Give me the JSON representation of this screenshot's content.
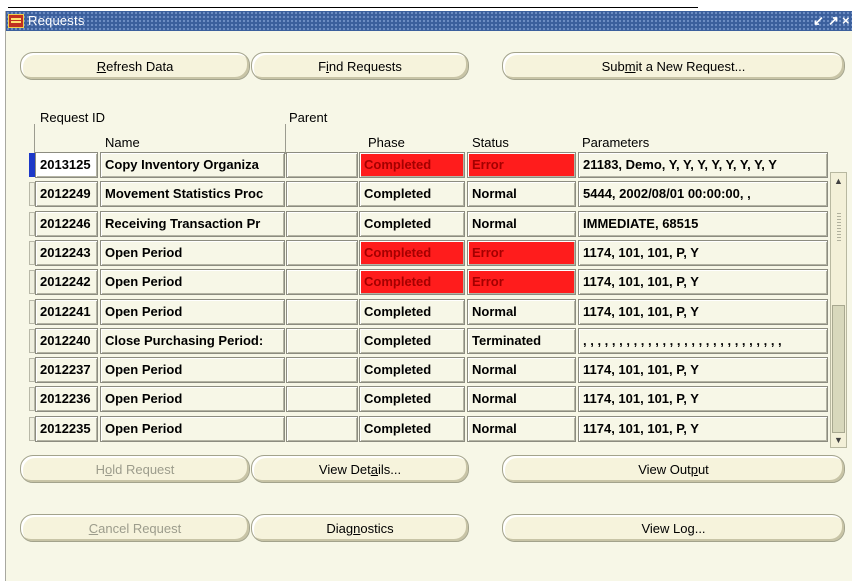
{
  "window": {
    "title": "Requests",
    "controls": [
      "↙",
      "↗",
      "×"
    ]
  },
  "buttons_top": {
    "refresh": {
      "pre": "",
      "key": "R",
      "post": "efresh Data"
    },
    "find": {
      "pre": "F",
      "key": "i",
      "post": "nd Requests"
    },
    "submit": {
      "pre": "Sub",
      "key": "m",
      "post": "it a New Request..."
    }
  },
  "headers": {
    "request_id": "Request ID",
    "parent": "Parent",
    "name": "Name",
    "phase": "Phase",
    "status": "Status",
    "parameters": "Parameters"
  },
  "rows": [
    {
      "id": "2013125",
      "name": "Copy Inventory Organiza",
      "parent": "",
      "phase": "Completed",
      "status": "Error",
      "params": "21183, Demo, Y, Y, Y, Y, Y, Y, Y, Y",
      "error": true,
      "active": true
    },
    {
      "id": "2012249",
      "name": "Movement Statistics Proc",
      "parent": "",
      "phase": "Completed",
      "status": "Normal",
      "params": "5444, 2002/08/01 00:00:00, ,",
      "error": false,
      "active": false
    },
    {
      "id": "2012246",
      "name": "Receiving Transaction Pr",
      "parent": "",
      "phase": "Completed",
      "status": "Normal",
      "params": "IMMEDIATE, 68515",
      "error": false,
      "active": false
    },
    {
      "id": "2012243",
      "name": "Open Period",
      "parent": "",
      "phase": "Completed",
      "status": "Error",
      "params": "1174, 101, 101, P, Y",
      "error": true,
      "active": false
    },
    {
      "id": "2012242",
      "name": "Open Period",
      "parent": "",
      "phase": "Completed",
      "status": "Error",
      "params": "1174, 101, 101, P, Y",
      "error": true,
      "active": false
    },
    {
      "id": "2012241",
      "name": "Open Period",
      "parent": "",
      "phase": "Completed",
      "status": "Normal",
      "params": "1174, 101, 101, P, Y",
      "error": false,
      "active": false
    },
    {
      "id": "2012240",
      "name": "Close Purchasing Period:",
      "parent": "",
      "phase": "Completed",
      "status": "Terminated",
      "params": ", , , , , , , , , , , , , , , , , , , , , , , , , , , ,",
      "error": false,
      "active": false
    },
    {
      "id": "2012237",
      "name": "Open Period",
      "parent": "",
      "phase": "Completed",
      "status": "Normal",
      "params": "1174, 101, 101, P, Y",
      "error": false,
      "active": false
    },
    {
      "id": "2012236",
      "name": "Open Period",
      "parent": "",
      "phase": "Completed",
      "status": "Normal",
      "params": "1174, 101, 101, P, Y",
      "error": false,
      "active": false
    },
    {
      "id": "2012235",
      "name": "Open Period",
      "parent": "",
      "phase": "Completed",
      "status": "Normal",
      "params": "1174, 101, 101, P, Y",
      "error": false,
      "active": false
    }
  ],
  "scrollbar": {
    "up": "▲",
    "down": "▼"
  },
  "buttons_bottom": {
    "hold": {
      "pre": "H",
      "key": "o",
      "post": "ld Request",
      "disabled": true
    },
    "details": {
      "pre": "View Det",
      "key": "a",
      "post": "ils...",
      "disabled": false
    },
    "output": {
      "pre": "View Out",
      "key": "p",
      "post": "ut",
      "disabled": false
    },
    "cancel": {
      "pre": "",
      "key": "C",
      "post": "ancel Request",
      "disabled": true
    },
    "diagnostics": {
      "pre": "Diag",
      "key": "n",
      "post": "ostics",
      "disabled": false
    },
    "log": {
      "pre": "View Lo",
      "key": "g",
      "post": "...",
      "disabled": false
    }
  },
  "colors": {
    "error_bg": "#ff1c1c",
    "error_text": "#a40000",
    "window_bg": "#f7f7e7",
    "title_bg": "#3b5f9c",
    "active_row_marker": "#1c38c8"
  }
}
